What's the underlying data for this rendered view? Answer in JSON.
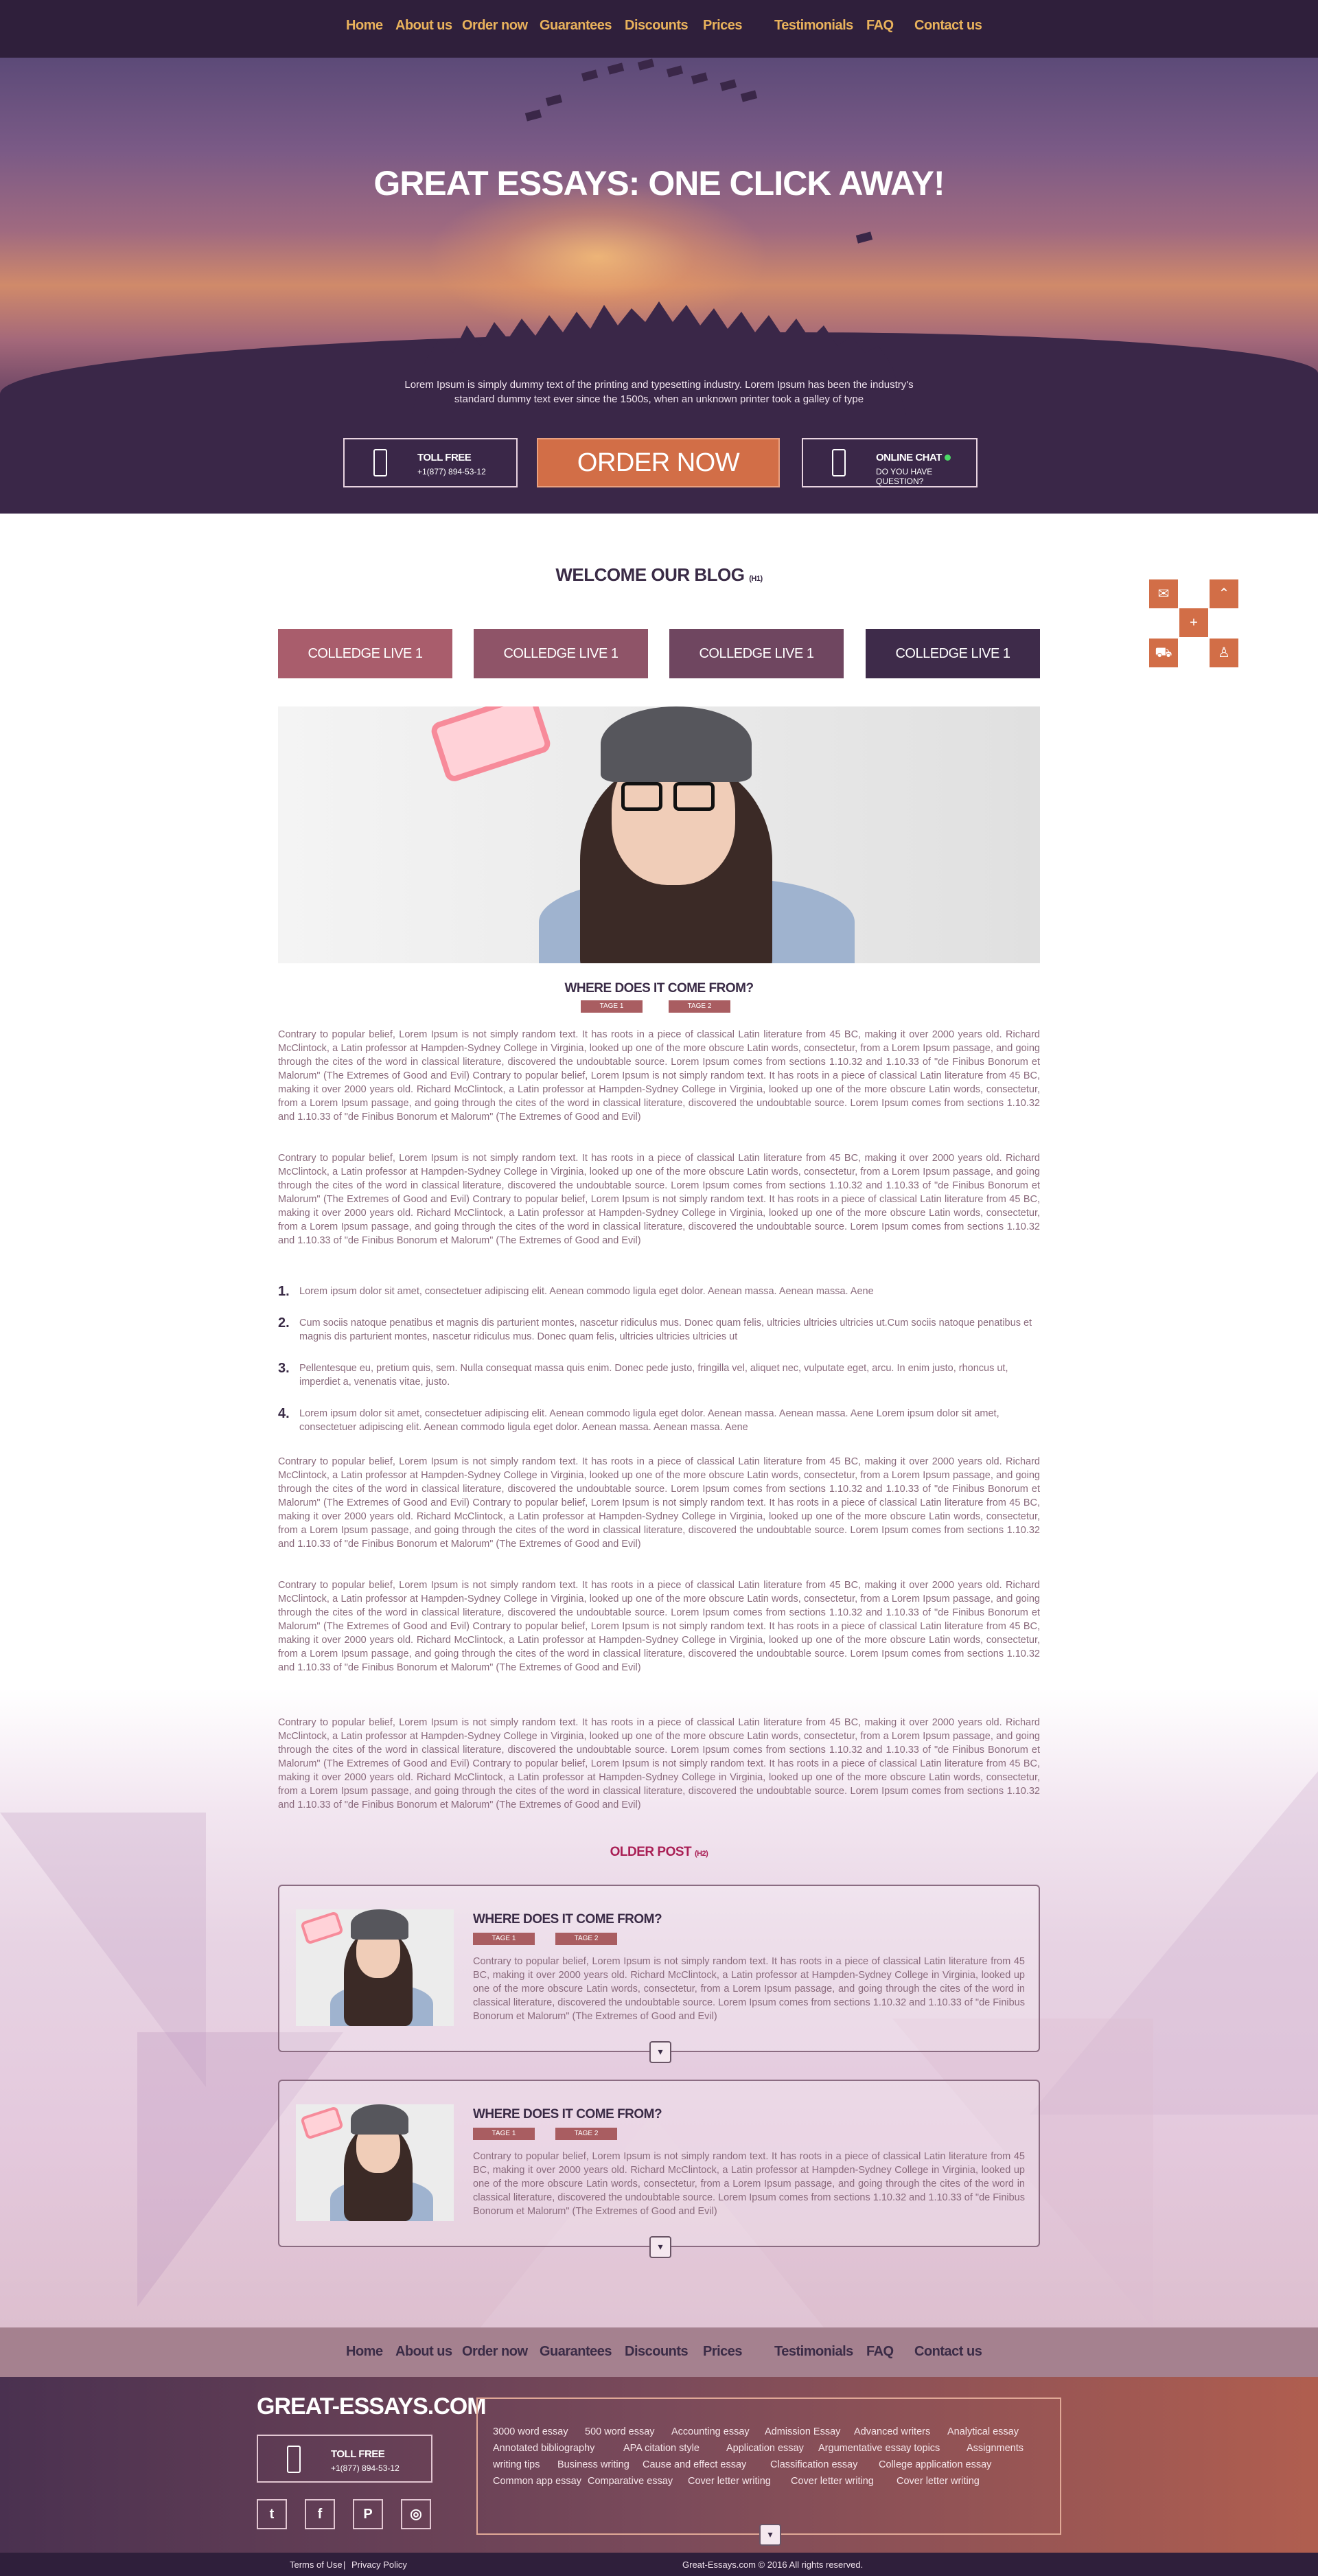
{
  "nav": {
    "items": [
      "Home",
      "About us",
      "Order now",
      "Guarantees",
      "Discounts",
      "Prices",
      "Testimonials",
      "FAQ",
      "Contact us"
    ]
  },
  "hero": {
    "title": "GREAT ESSAYS: ONE CLICK AWAY!",
    "lead": "Lorem Ipsum is simply dummy text of the printing and typesetting industry. Lorem Ipsum has been the industry's standard dummy text ever since the 1500s, when an unknown printer took a galley of type",
    "toll_free_label": "TOLL FREE",
    "toll_free_number": "+1(877) 894-53-12",
    "order_button": "ORDER NOW",
    "chat_label": "ONLINE CHAT",
    "chat_sub": "DO YOU HAVE QUESTION?"
  },
  "blog": {
    "title": "WELCOME OUR BLOG",
    "title_tag": "(H1)",
    "categories": [
      "COLLEDGE LIVE 1",
      "COLLEDGE LIVE 1",
      "COLLEDGE LIVE 1",
      "COLLEDGE LIVE 1"
    ],
    "category_colors": [
      "#a95d6c",
      "#8f5468",
      "#6f4660",
      "#3e2b4a"
    ],
    "article_title": "WHERE DOES IT COME FROM?",
    "tags": [
      "TAGE 1",
      "TAGE 2"
    ],
    "paragraphs": [
      "Contrary to popular belief, Lorem Ipsum is not simply random text. It has roots in a piece of classical Latin literature from 45 BC, making it over 2000 years old. Richard McClintock, a Latin professor at Hampden-Sydney College in Virginia, looked up one of the more obscure Latin words, consectetur, from a Lorem Ipsum passage, and going through the cites of the word in classical literature, discovered the undoubtable source. Lorem Ipsum comes from sections 1.10.32 and 1.10.33 of \"de Finibus Bonorum et Malorum\" (The Extremes of Good and Evil) Contrary to popular belief, Lorem Ipsum is not simply random text. It has roots in a piece of classical Latin literature from 45 BC, making it over 2000 years old. Richard McClintock, a Latin professor at Hampden-Sydney College in Virginia, looked up one of the more obscure Latin words, consectetur, from a Lorem Ipsum passage, and going through the cites of the word in classical literature, discovered the undoubtable source. Lorem Ipsum comes from sections 1.10.32 and 1.10.33 of \"de Finibus Bonorum et Malorum\" (The Extremes of Good and Evil)",
      "Contrary to popular belief, Lorem Ipsum is not simply random text. It has roots in a piece of classical Latin literature from 45 BC, making it over 2000 years old. Richard McClintock, a Latin professor at Hampden-Sydney College in Virginia, looked up one of the more obscure Latin words, consectetur, from a Lorem Ipsum passage, and going through the cites of the word in classical literature, discovered the undoubtable source. Lorem Ipsum comes from sections 1.10.32 and 1.10.33 of \"de Finibus Bonorum et Malorum\" (The Extremes of Good and Evil) Contrary to popular belief, Lorem Ipsum is not simply random text. It has roots in a piece of classical Latin literature from 45 BC, making it over 2000 years old. Richard McClintock, a Latin professor at Hampden-Sydney College in Virginia, looked up one of the more obscure Latin words, consectetur, from a Lorem Ipsum passage, and going through the cites of the word in classical literature, discovered the undoubtable source. Lorem Ipsum comes from sections 1.10.32 and 1.10.33 of \"de Finibus Bonorum et Malorum\" (The Extremes of Good and Evil)",
      "Contrary to popular belief, Lorem Ipsum is not simply random text. It has roots in a piece of classical Latin literature from 45 BC, making it over 2000 years old. Richard McClintock, a Latin professor at Hampden-Sydney College in Virginia, looked up one of the more obscure Latin words, consectetur, from a Lorem Ipsum passage, and going through the cites of the word in classical literature, discovered the undoubtable source. Lorem Ipsum comes from sections 1.10.32 and 1.10.33 of \"de Finibus Bonorum et Malorum\" (The Extremes of Good and Evil) Contrary to popular belief, Lorem Ipsum is not simply random text. It has roots in a piece of classical Latin literature from 45 BC, making it over 2000 years old. Richard McClintock, a Latin professor at Hampden-Sydney College in Virginia, looked up one of the more obscure Latin words, consectetur, from a Lorem Ipsum passage, and going through the cites of the word in classical literature, discovered the undoubtable source. Lorem Ipsum comes from sections 1.10.32 and 1.10.33 of \"de Finibus Bonorum et Malorum\" (The Extremes of Good and Evil)",
      "Contrary to popular belief, Lorem Ipsum is not simply random text. It has roots in a piece of classical Latin literature from 45 BC, making it over 2000 years old. Richard McClintock, a Latin professor at Hampden-Sydney College in Virginia, looked up one of the more obscure Latin words, consectetur, from a Lorem Ipsum passage, and going through the cites of the word in classical literature, discovered the undoubtable source. Lorem Ipsum comes from sections 1.10.32 and 1.10.33 of \"de Finibus Bonorum et Malorum\" (The Extremes of Good and Evil) Contrary to popular belief, Lorem Ipsum is not simply random text. It has roots in a piece of classical Latin literature from 45 BC, making it over 2000 years old. Richard McClintock, a Latin professor at Hampden-Sydney College in Virginia, looked up one of the more obscure Latin words, consectetur, from a Lorem Ipsum passage, and going through the cites of the word in classical literature, discovered the undoubtable source. Lorem Ipsum comes from sections 1.10.32 and 1.10.33 of \"de Finibus Bonorum et Malorum\" (The Extremes of Good and Evil)",
      "Contrary to popular belief, Lorem Ipsum is not simply random text. It has roots in a piece of classical Latin literature from 45 BC, making it over 2000 years old. Richard McClintock, a Latin professor at Hampden-Sydney College in Virginia, looked up one of the more obscure Latin words, consectetur, from a Lorem Ipsum passage, and going through the cites of the word in classical literature, discovered the undoubtable source. Lorem Ipsum comes from sections 1.10.32 and 1.10.33 of \"de Finibus Bonorum et Malorum\" (The Extremes of Good and Evil) Contrary to popular belief, Lorem Ipsum is not simply random text. It has roots in a piece of classical Latin literature from 45 BC, making it over 2000 years old. Richard McClintock, a Latin professor at Hampden-Sydney College in Virginia, looked up one of the more obscure Latin words, consectetur, from a Lorem Ipsum passage, and going through the cites of the word in classical literature, discovered the undoubtable source. Lorem Ipsum comes from sections 1.10.32 and 1.10.33 of \"de Finibus Bonorum et Malorum\" (The Extremes of Good and Evil)"
    ],
    "list": [
      "Lorem ipsum dolor sit amet, consectetuer adipiscing elit. Aenean commodo ligula eget dolor. Aenean massa. Aenean massa. Aene",
      "Cum sociis natoque penatibus et magnis dis parturient montes, nascetur ridiculus mus. Donec quam felis, ultricies ultricies ultricies ut.Cum sociis natoque penatibus et magnis dis parturient montes, nascetur ridiculus mus. Donec quam felis, ultricies ultricies ultricies ut",
      "Pellentesque eu, pretium quis, sem. Nulla consequat massa quis enim. Donec pede justo, fringilla vel, aliquet nec, vulputate eget, arcu. In enim justo, rhoncus ut, imperdiet a, venenatis vitae, justo.",
      "Lorem ipsum dolor sit amet, consectetuer adipiscing elit. Aenean commodo ligula eget dolor. Aenean massa. Aenean massa. Aene Lorem ipsum dolor sit amet, consectetuer adipiscing elit. Aenean commodo ligula eget dolor. Aenean massa. Aenean massa. Aene"
    ]
  },
  "older": {
    "title": "OLDER POST",
    "title_tag": "(H2)",
    "posts": [
      {
        "title": "WHERE DOES IT COME FROM?",
        "tags": [
          "TAGE 1",
          "TAGE 2"
        ],
        "text": "Contrary to popular belief, Lorem Ipsum is not simply random text. It has roots in a piece of classical Latin literature from 45 BC, making it over 2000 years old. Richard McClintock, a Latin professor at Hampden-Sydney College in Virginia, looked up one of the more obscure Latin words, consectetur, from a Lorem Ipsum passage, and going through the cites of the word in classical literature, discovered the undoubtable source. Lorem Ipsum comes from sections 1.10.32 and 1.10.33 of \"de Finibus Bonorum et Malorum\" (The Extremes of Good and Evil)",
        "expand": "▾"
      },
      {
        "title": "WHERE DOES IT COME FROM?",
        "tags": [
          "TAGE 1",
          "TAGE 2"
        ],
        "text": "Contrary to popular belief, Lorem Ipsum is not simply random text. It has roots in a piece of classical Latin literature from 45 BC, making it over 2000 years old. Richard McClintock, a Latin professor at Hampden-Sydney College in Virginia, looked up one of the more obscure Latin words, consectetur, from a Lorem Ipsum passage, and going through the cites of the word in classical literature, discovered the undoubtable source. Lorem Ipsum comes from sections 1.10.32 and 1.10.33 of \"de Finibus Bonorum et Malorum\" (The Extremes of Good and Evil)",
        "expand": "▾"
      }
    ]
  },
  "side_tools": {
    "icons": [
      "chat-icon",
      "arrow-up-icon",
      "plus-icon",
      "cart-icon",
      "user-icon"
    ],
    "glyphs": [
      "✉",
      "⌃",
      "+",
      "⛟",
      "♙"
    ]
  },
  "footer": {
    "nav": [
      "Home",
      "About us",
      "Order now",
      "Guarantees",
      "Discounts",
      "Prices",
      "Testimonials",
      "FAQ",
      "Contact us"
    ],
    "logo": "GREAT-ESSAYS.COM",
    "toll_free_label": "TOLL FREE",
    "toll_free_number": "+1(877) 894-53-12",
    "social": [
      {
        "name": "twitter-icon",
        "glyph": "t"
      },
      {
        "name": "facebook-icon",
        "glyph": "f"
      },
      {
        "name": "pinterest-icon",
        "glyph": "P"
      },
      {
        "name": "instagram-icon",
        "glyph": "◎"
      }
    ],
    "links": [
      [
        "3000 word essay",
        "500 word essay",
        "Accounting essay",
        "Admission Essay",
        "Advanced writers",
        "Analytical essay"
      ],
      [
        "Annotated bibliography",
        "APA citation style",
        "Application essay",
        "Argumentative essay topics",
        "Assignments"
      ],
      [
        "writing tips",
        "Business writing",
        "Cause and effect essay",
        "Classification essay",
        "College application essay"
      ],
      [
        "Common app essay",
        "Comparative essay",
        "Cover letter writing",
        "Cover letter writing",
        "Cover letter writing"
      ]
    ],
    "expand": "▾",
    "terms": "Terms of Use",
    "separator": "|",
    "privacy": "Privacy Policy",
    "copyright": "Great-Essays.com © 2016 All rights reserved."
  }
}
